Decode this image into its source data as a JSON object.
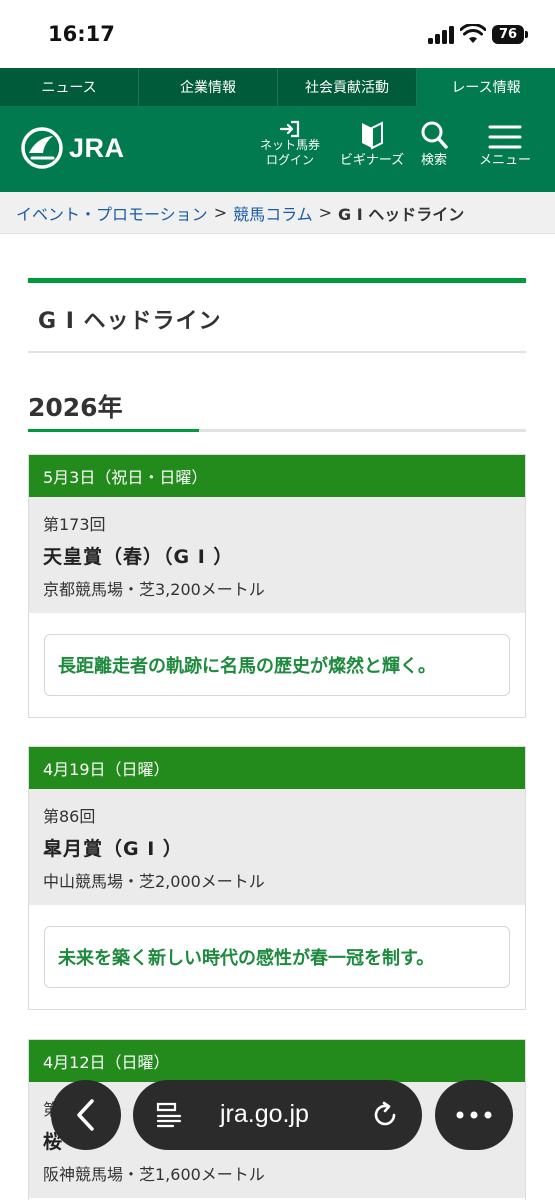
{
  "status": {
    "time": "16:17",
    "battery": "76"
  },
  "top_nav": [
    "ニュース",
    "企業情報",
    "社会貢献活動",
    "レース情報"
  ],
  "header": {
    "logo": "JRA",
    "login_line1": "ネット馬券",
    "login_line2": "ログイン",
    "beginners": "ビギナーズ",
    "search": "検索",
    "menu": "メニュー"
  },
  "breadcrumb": {
    "item1": "イベント・プロモーション",
    "item2": "競馬コラム",
    "current": "G I  ヘッドライン",
    "separator": ">"
  },
  "page_title": "G I  ヘッドライン",
  "year": "2026年",
  "races": [
    {
      "date": "5月3日（祝日・日曜）",
      "round": "第173回",
      "name": "天皇賞（春）（G I ）",
      "venue": "京都競馬場・芝3,200メートル",
      "headline": "長距離走者の軌跡に名馬の歴史が燦然と輝く。"
    },
    {
      "date": "4月19日（日曜）",
      "round": "第86回",
      "name": "皐月賞（G I ）",
      "venue": "中山競馬場・芝2,000メートル",
      "headline": "未来を築く新しい時代の感性が春一冠を制す。"
    },
    {
      "date": "4月12日（日曜）",
      "round": "第",
      "name": "桜",
      "venue": "阪神競馬場・芝1,600メートル",
      "headline": ""
    }
  ],
  "browser": {
    "url": "jra.go.jp"
  }
}
